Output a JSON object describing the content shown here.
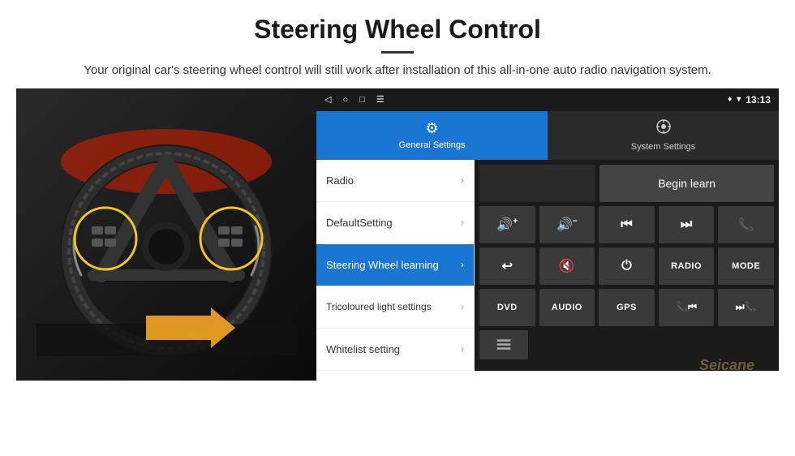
{
  "header": {
    "title": "Steering Wheel Control",
    "divider": true,
    "subtitle": "Your original car's steering wheel control will still work after installation of this all-in-one auto radio navigation system."
  },
  "statusBar": {
    "left": {
      "back": "◁",
      "home": "○",
      "square": "□",
      "menu": "☰"
    },
    "right": {
      "location": "♦",
      "wifi": "▾",
      "time": "13:13"
    }
  },
  "tabs": [
    {
      "id": "general",
      "icon": "⚙",
      "label": "General Settings",
      "active": true
    },
    {
      "id": "system",
      "icon": "⚙",
      "label": "System Settings",
      "active": false
    }
  ],
  "menuItems": [
    {
      "id": "radio",
      "label": "Radio",
      "active": false
    },
    {
      "id": "default",
      "label": "DefaultSetting",
      "active": false
    },
    {
      "id": "steering",
      "label": "Steering Wheel learning",
      "active": true
    },
    {
      "id": "tricoloured",
      "label": "Tricoloured light settings",
      "active": false
    },
    {
      "id": "whitelist",
      "label": "Whitelist setting",
      "active": false
    }
  ],
  "controlPanel": {
    "beginLearnLabel": "Begin learn",
    "buttons": [
      [
        "🔊+",
        "🔊−",
        "⏮",
        "⏭",
        "📞"
      ],
      [
        "↩",
        "🔇",
        "⏻",
        "RADIO",
        "MODE"
      ],
      [
        "DVD",
        "AUDIO",
        "GPS",
        "📞⏮",
        "⏭📞"
      ]
    ]
  },
  "watermark": "Seicane"
}
